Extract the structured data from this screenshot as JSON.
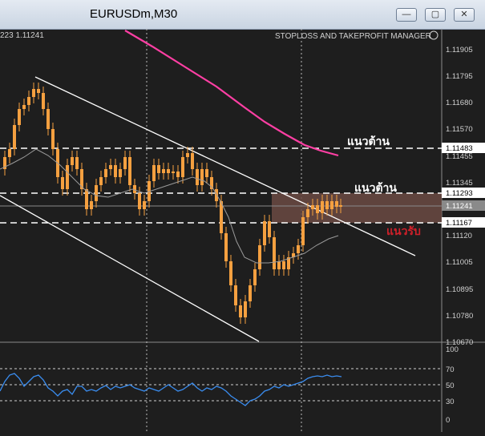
{
  "window": {
    "title": "EURUSDm,M30",
    "minimize_label": "—",
    "maximize_label": "▢",
    "close_label": "✕"
  },
  "chart": {
    "info_text": "223 1.11241",
    "manager_label": "STOPLOSS AND TAKEPROFIT MANAGER",
    "price_ticks": [
      "1.11905",
      "1.11795",
      "1.11680",
      "1.11570",
      "1.11455",
      "1.11345",
      "1.11120",
      "1.11005",
      "1.10895",
      "1.10780",
      "1.10670"
    ],
    "price_labels": {
      "resistance_1": "1.11483",
      "resistance_2": "1.11293",
      "current": "1.11241",
      "support": "1.11167"
    },
    "annotations": {
      "resistance_1": "แนวต้าน",
      "resistance_2": "แนวต้าน",
      "support": "แนวรับ"
    },
    "colors": {
      "background": "#1e1e1e",
      "candles": "#f5a040",
      "ma_slow": "#ff3fa4",
      "ma_fast": "#9a9a9a",
      "channel": "#ffffff",
      "zone": "#6b4a43",
      "oscillator": "#3a8df0"
    }
  },
  "oscillator": {
    "levels": [
      "100",
      "70",
      "50",
      "30",
      "0"
    ]
  }
}
